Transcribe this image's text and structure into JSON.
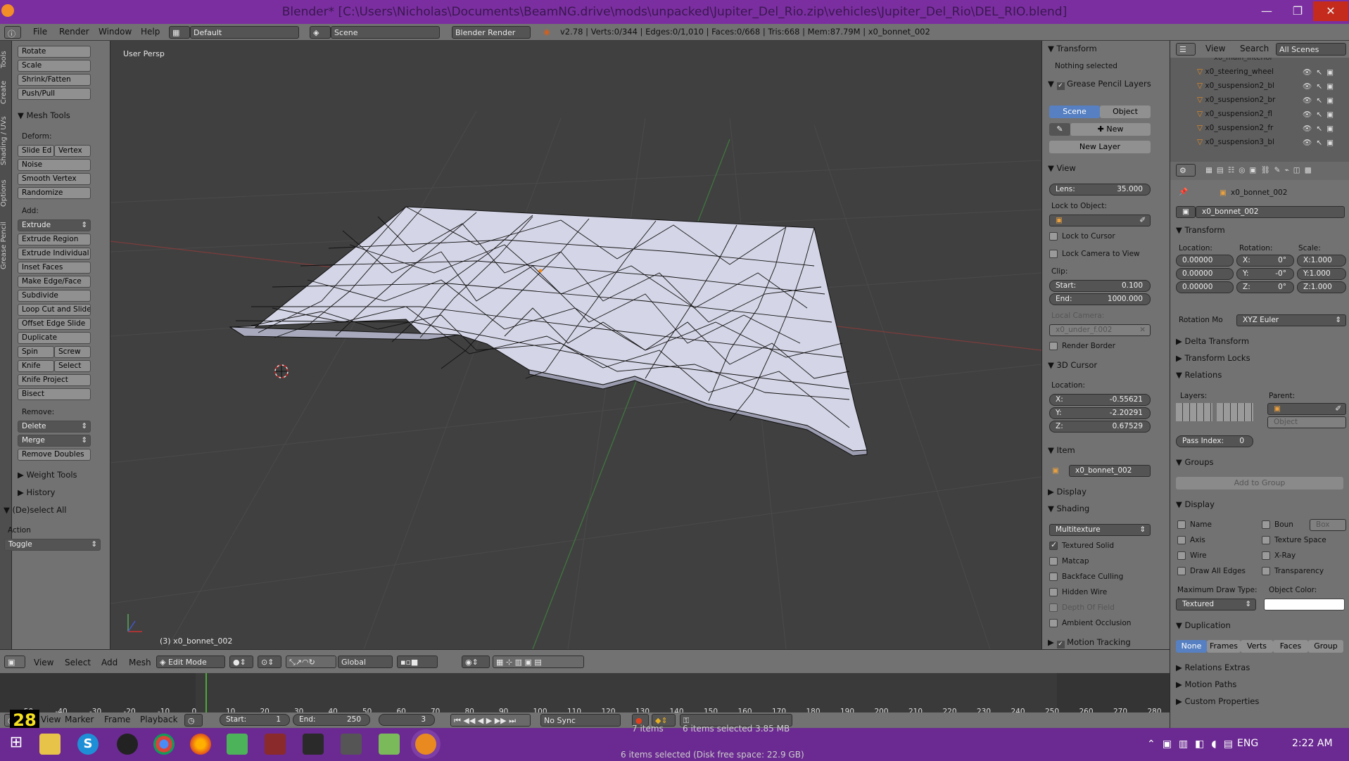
{
  "window": {
    "title": "Blender* [C:\\Users\\Nicholas\\Documents\\BeamNG.drive\\mods\\unpacked\\Jupiter_Del_Rio.zip\\vehicles\\Jupiter_Del_Rio\\DEL_RIO.blend]",
    "minimize": "—",
    "maximize": "❐",
    "close": "✕"
  },
  "topbar": {
    "menus": [
      "File",
      "Render",
      "Window",
      "Help"
    ],
    "layout": "Default",
    "scene": "Scene",
    "engine": "Blender Render",
    "info": "v2.78 | Verts:0/344 | Edges:0/1,010 | Faces:0/668 | Tris:668 | Mem:87.79M | x0_bonnet_002"
  },
  "lefttabs": [
    "Tools",
    "Create",
    "Shading / UVs",
    "Options",
    "Grease Pencil"
  ],
  "toolshelf": {
    "transform_items": [
      "Rotate",
      "Scale",
      "Shrink/Fatten",
      "Push/Pull"
    ],
    "mesh_tools_header": "Mesh Tools",
    "deform_label": "Deform:",
    "deform_pair": [
      "Slide Ed",
      "Vertex"
    ],
    "deform_items": [
      "Noise",
      "Smooth Vertex",
      "Randomize"
    ],
    "add_label": "Add:",
    "extrude": "Extrude",
    "add_items": [
      "Extrude Region",
      "Extrude Individual",
      "Inset Faces",
      "Make Edge/Face",
      "Subdivide",
      "Loop Cut and Slide",
      "Offset Edge Slide",
      "Duplicate"
    ],
    "spin_pair": [
      "Spin",
      "Screw"
    ],
    "knife_pair": [
      "Knife",
      "Select"
    ],
    "add_items2": [
      "Knife Project",
      "Bisect"
    ],
    "remove_label": "Remove:",
    "delete": "Delete",
    "merge": "Merge",
    "remove_doubles": "Remove Doubles",
    "weight_tools": "Weight Tools",
    "history": "History",
    "deselect_header": "(De)select All",
    "action_label": "Action",
    "action_value": "Toggle"
  },
  "viewport": {
    "label": "User Persp",
    "object_label": "(3) x0_bonnet_002"
  },
  "npanel": {
    "transform": "Transform",
    "nothing_selected": "Nothing selected",
    "grease": "Grease Pencil Layers",
    "scene_tab": "Scene",
    "object_tab": "Object",
    "new": "New",
    "new_layer": "New Layer",
    "view": "View",
    "lens": "Lens:",
    "lens_value": "35.000",
    "lock_to_object": "Lock to Object:",
    "lock_cursor": "Lock to Cursor",
    "lock_camera": "Lock Camera to View",
    "clip": "Clip:",
    "start": "Start:",
    "start_value": "0.100",
    "end": "End:",
    "end_value": "1000.000",
    "local_camera": "Local Camera:",
    "local_camera_value": "x0_under_f.002",
    "render_border": "Render Border",
    "cursor": "3D Cursor",
    "location": "Location:",
    "cx": "X:",
    "cx_value": "-0.55621",
    "cy": "Y:",
    "cy_value": "-2.20291",
    "cz": "Z:",
    "cz_value": "0.67529",
    "item": "Item",
    "item_name": "x0_bonnet_002",
    "display": "Display",
    "shading": "Shading",
    "shading_mode": "Multitexture",
    "textured_solid": "Textured Solid",
    "matcap": "Matcap",
    "backface": "Backface Culling",
    "hidden_wire": "Hidden Wire",
    "dof": "Depth Of Field",
    "ao": "Ambient Occlusion",
    "motion_tracking": "Motion Tracking"
  },
  "outliner": {
    "menus": [
      "View",
      "Search"
    ],
    "scene_filter": "All Scenes",
    "top_item": "x0_main_interior",
    "items": [
      "x0_steering_wheel",
      "x0_suspension2_bl",
      "x0_suspension2_br",
      "x0_suspension2_fl",
      "x0_suspension2_fr",
      "x0_suspension3_bl"
    ]
  },
  "props": {
    "object_path": "x0_bonnet_002",
    "object_name": "x0_bonnet_002",
    "transform": "Transform",
    "location": "Location:",
    "rotation": "Rotation:",
    "scale": "Scale:",
    "loc": [
      "0.00000",
      "0.00000",
      "0.00000"
    ],
    "rot": [
      "X:",
      "0°",
      "Y:",
      "-0°",
      "Z:",
      "0°"
    ],
    "scl": [
      "X:",
      "1.000",
      "Y:",
      "1.000",
      "Z:",
      "1.000"
    ],
    "rotation_mode_label": "Rotation Mo",
    "rotation_mode": "XYZ Euler",
    "delta": "Delta Transform",
    "locks": "Transform Locks",
    "relations": "Relations",
    "layers": "Layers:",
    "parent": "Parent:",
    "parent_type": "Object",
    "pass_index": "Pass Index:",
    "pass_value": "0",
    "groups": "Groups",
    "add_to_group": "Add to Group",
    "display": "Display",
    "name": "Name",
    "bounds": "Boun",
    "bounds_type": "Box",
    "axis": "Axis",
    "texture_space": "Texture Space",
    "wire": "Wire",
    "xray": "X-Ray",
    "all_edges": "Draw All Edges",
    "transparency": "Transparency",
    "max_draw": "Maximum Draw Type:",
    "object_color": "Object Color:",
    "max_draw_value": "Textured",
    "duplication": "Duplication",
    "dup_tabs": [
      "None",
      "Frames",
      "Verts",
      "Faces",
      "Group"
    ],
    "relations_extras": "Relations Extras",
    "motion_paths": "Motion Paths",
    "custom_props": "Custom Properties"
  },
  "vheader": {
    "menus": [
      "View",
      "Select",
      "Add",
      "Mesh"
    ],
    "mode": "Edit Mode",
    "orientation": "Global"
  },
  "timeline": {
    "ticks": [
      "-50",
      "-40",
      "-30",
      "-20",
      "-10",
      "0",
      "10",
      "20",
      "30",
      "40",
      "50",
      "60",
      "70",
      "80",
      "90",
      "100",
      "110",
      "120",
      "130",
      "140",
      "150",
      "160",
      "170",
      "180",
      "190",
      "200",
      "210",
      "220",
      "230",
      "240",
      "250",
      "260",
      "270",
      "280"
    ]
  },
  "tlheader": {
    "menus": [
      "View",
      "Marker",
      "Frame",
      "Playback"
    ],
    "start": "Start:",
    "start_value": "1",
    "end": "End:",
    "end_value": "250",
    "current": "3",
    "sync": "No Sync",
    "frame_overlay": "28"
  },
  "taskbar": {
    "status_text1": "7 items",
    "status_text2": "6 items selected  3.85 MB",
    "status_text3": "6 items selected (Disk free space: 22.9 GB)",
    "lang": "ENG",
    "clock": "2:22 AM"
  },
  "colors": {
    "title": "#7b2ea0",
    "taskbar": "#6b2a91",
    "panel": "#727272",
    "viewport": "#404040",
    "active": "#5680c2",
    "mesh": "#d4d5e6"
  }
}
